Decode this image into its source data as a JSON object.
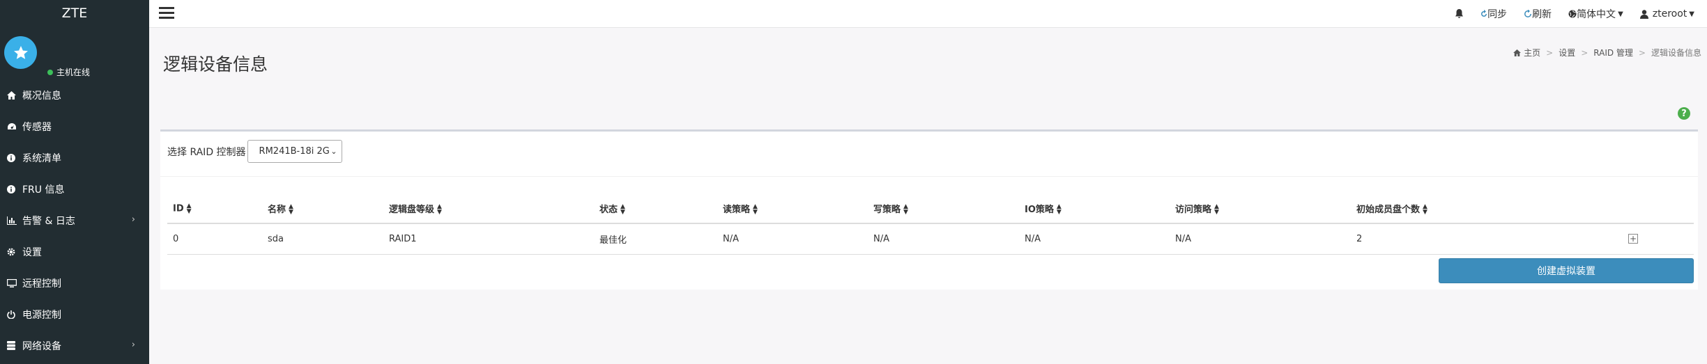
{
  "app": {
    "brand": "ZTE"
  },
  "user_panel": {
    "status": "主机在线"
  },
  "sidebar": {
    "items": [
      {
        "label": "概况信息",
        "icon": "home-icon"
      },
      {
        "label": "传感器",
        "icon": "dashboard-icon"
      },
      {
        "label": "系统清单",
        "icon": "info-icon"
      },
      {
        "label": "FRU 信息",
        "icon": "info-icon"
      },
      {
        "label": "告警 & 日志",
        "icon": "chart-icon",
        "has_submenu": true
      },
      {
        "label": "设置",
        "icon": "gear-icon"
      },
      {
        "label": "远程控制",
        "icon": "monitor-icon"
      },
      {
        "label": "电源控制",
        "icon": "power-icon"
      },
      {
        "label": "网络设备",
        "icon": "database-icon",
        "has_submenu": true
      }
    ]
  },
  "header": {
    "sync_label": "同步",
    "refresh_label": "刷新",
    "language_label": "简体中文",
    "username": "zteroot"
  },
  "page": {
    "title": "逻辑设备信息"
  },
  "breadcrumb": {
    "home": "主页",
    "settings": "设置",
    "raid": "RAID 管理",
    "current": "逻辑设备信息"
  },
  "controller": {
    "label": "选择 RAID 控制器",
    "selected": "RM241B-18i 2G"
  },
  "table": {
    "columns": [
      "ID",
      "名称",
      "逻辑盘等级",
      "状态",
      "读策略",
      "写策略",
      "IO策略",
      "访问策略",
      "初始成员盘个数"
    ],
    "rows": [
      [
        "0",
        "sda",
        "RAID1",
        "最佳化",
        "N/A",
        "N/A",
        "N/A",
        "N/A",
        "2"
      ]
    ]
  },
  "actions": {
    "create_label": "创建虚拟装置"
  },
  "colors": {
    "sidebar_bg": "#222d32",
    "accent": "#3c8dbc",
    "avatar": "#3ab0e8",
    "online": "#3cbf5a",
    "help": "#4cae4c"
  }
}
